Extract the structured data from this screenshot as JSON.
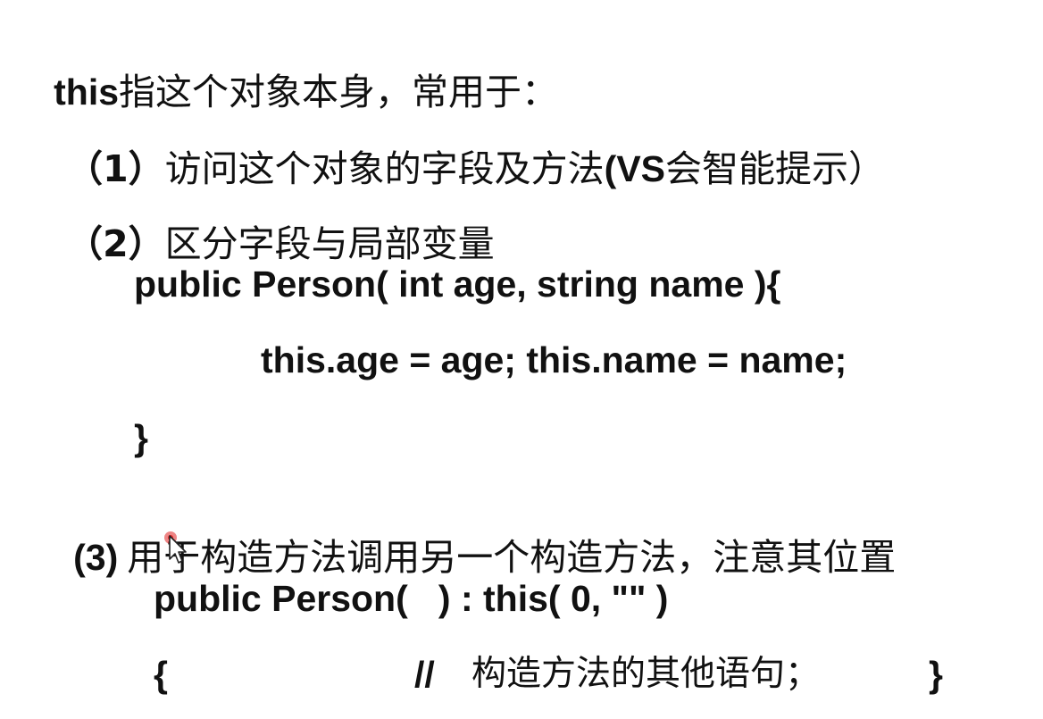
{
  "slide": {
    "heading": {
      "keyword": "this",
      "text": "指这个对象本身，常用于："
    },
    "items": [
      {
        "marker": "（1）",
        "text_a": "访问这个对象的字段及方法",
        "latin": "(VS",
        "text_b": "会智能提示）"
      },
      {
        "marker": "（2）",
        "text": "区分字段与局部变量"
      },
      {
        "marker": "(3)",
        "text": "用于构造方法调用另一个构造方法，注意其位置"
      }
    ],
    "code_block_1": {
      "line1": "public Person( int age, string name ){",
      "line2": "this.age = age; this.name = name;",
      "line3": "}"
    },
    "code_block_2": {
      "line1": "public Person(   ) : this( 0, \"\" )",
      "open_brace": "{",
      "comment_marker": "//",
      "comment_text": "构造方法的其他语句；",
      "close_brace": "}"
    }
  },
  "cursor": {
    "icon": "mouse-pointer-icon",
    "highlight_color": "#e02020"
  },
  "colors": {
    "background": "#ffffff",
    "text": "#111111"
  }
}
